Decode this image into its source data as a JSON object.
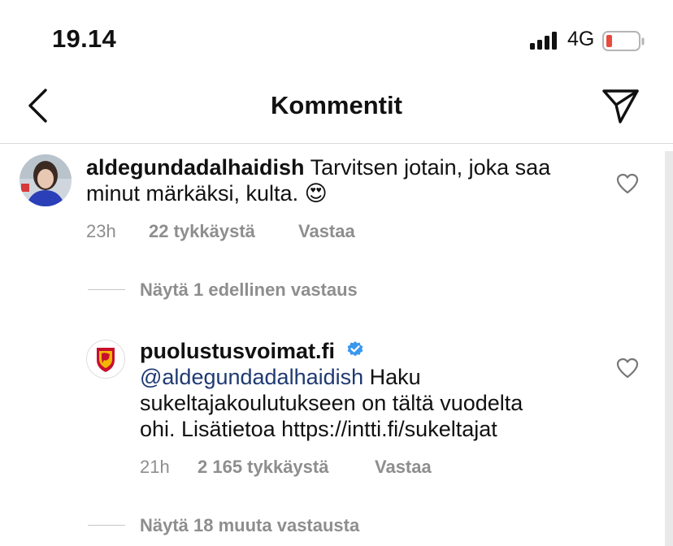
{
  "status_bar": {
    "time": "19.14",
    "network": "4G",
    "battery_color": "#e84b3c"
  },
  "header": {
    "title": "Kommentit"
  },
  "comments": [
    {
      "username": "aldegundadalhaidish",
      "text_line1": "Tarvitsen jotain, joka saa",
      "text_line2": "minut märkäksi, kulta. 😍",
      "time": "23h",
      "likes": "22 tykkäystä",
      "reply": "Vastaa"
    },
    {
      "username": "puolustusvoimat.fi",
      "verified": true,
      "mention": "@aldegundadalhaidish",
      "text_line1": "Haku",
      "text_line2": "sukeltajakoulutukseen on tältä vuodelta",
      "text_line3": "ohi. Lisätietoa https://intti.fi/sukeltajat",
      "time": "21h",
      "likes": "2 165 tykkäystä",
      "reply": "Vastaa"
    }
  ],
  "view_previous_replies": "Näytä 1 edellinen vastaus",
  "view_more_replies": "Näytä 18 muuta vastausta",
  "colors": {
    "verified": "#3897f0",
    "mention": "#1f3a72",
    "meta": "#8e8e8e",
    "crest": "#c8102e"
  }
}
